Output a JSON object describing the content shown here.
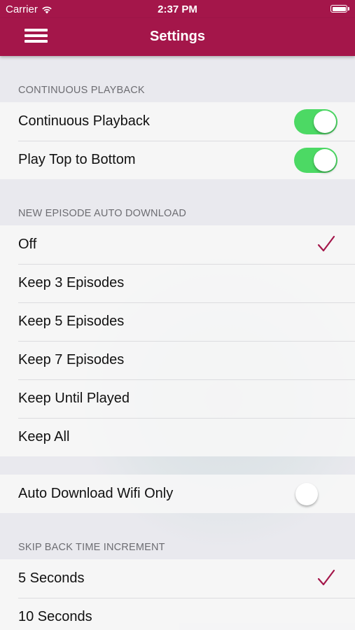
{
  "status_bar": {
    "carrier": "Carrier",
    "time": "2:37 PM"
  },
  "nav": {
    "title": "Settings"
  },
  "sections": {
    "continuous_playback": {
      "header": "CONTINUOUS PLAYBACK",
      "items": [
        {
          "label": "Continuous Playback",
          "toggle": true
        },
        {
          "label": "Play Top to Bottom",
          "toggle": true
        }
      ]
    },
    "auto_download": {
      "header": "NEW EPISODE AUTO DOWNLOAD",
      "items": [
        {
          "label": "Off",
          "selected": true
        },
        {
          "label": "Keep 3 Episodes"
        },
        {
          "label": "Keep 5 Episodes"
        },
        {
          "label": "Keep 7 Episodes"
        },
        {
          "label": "Keep Until Played"
        },
        {
          "label": "Keep All"
        }
      ]
    },
    "wifi": {
      "items": [
        {
          "label": "Auto Download Wifi Only",
          "toggle": false
        }
      ]
    },
    "skip_back": {
      "header": "SKIP BACK TIME INCREMENT",
      "items": [
        {
          "label": "5 Seconds",
          "selected": true
        },
        {
          "label": "10 Seconds"
        }
      ]
    }
  },
  "colors": {
    "accent": "#a4164a",
    "toggle_on": "#4cd964",
    "check": "#a4164a"
  }
}
